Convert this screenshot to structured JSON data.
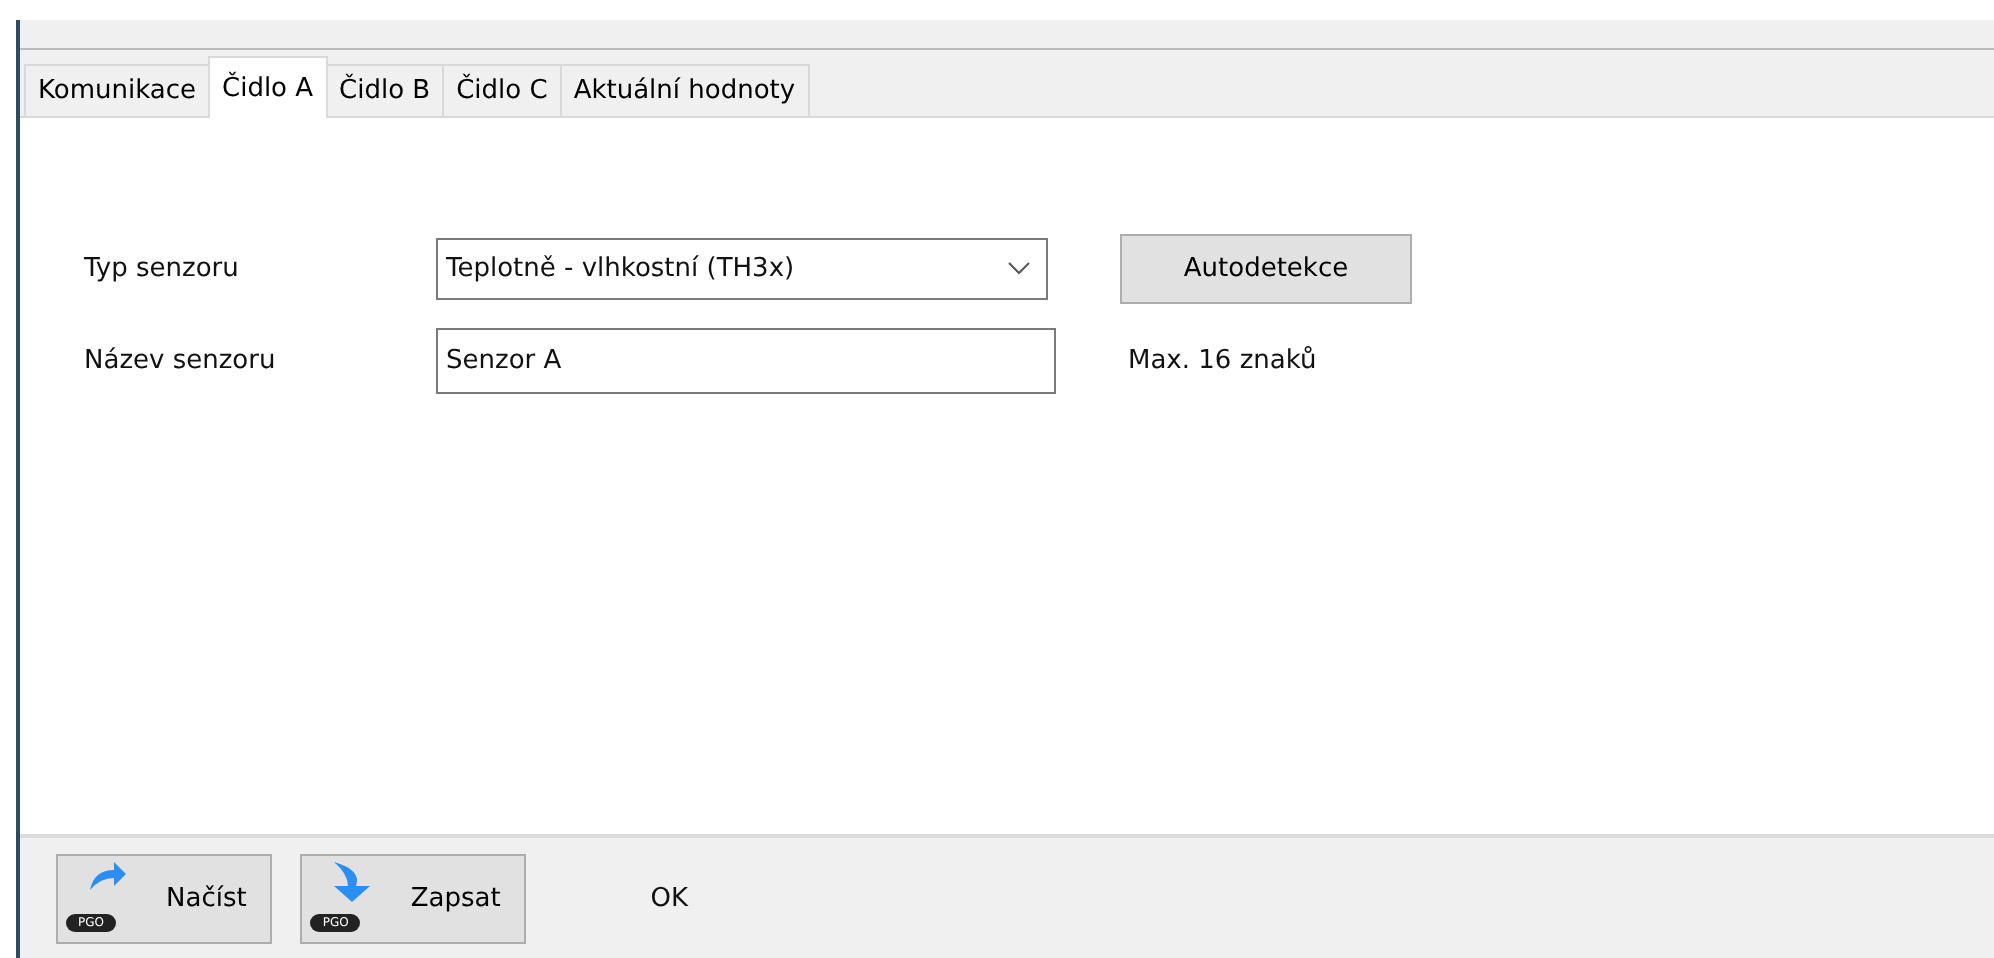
{
  "tabs": [
    {
      "label": "Komunikace",
      "selected": false
    },
    {
      "label": "Čidlo A",
      "selected": true
    },
    {
      "label": "Čidlo B",
      "selected": false
    },
    {
      "label": "Čidlo C",
      "selected": false
    },
    {
      "label": "Aktuální hodnoty",
      "selected": false
    }
  ],
  "form": {
    "sensor_type": {
      "label": "Typ senzoru",
      "value": "Teplotně - vlhkostní (TH3x)",
      "button": "Autodetekce"
    },
    "sensor_name": {
      "label": "Název senzoru",
      "value": "Senzor A",
      "hint": "Max. 16 znaků"
    }
  },
  "footer": {
    "buttons": [
      {
        "label": "Načíst",
        "badge": "PGO",
        "kind": "read"
      },
      {
        "label": "Zapsat",
        "badge": "PGO",
        "kind": "write"
      }
    ],
    "status": "OK"
  }
}
